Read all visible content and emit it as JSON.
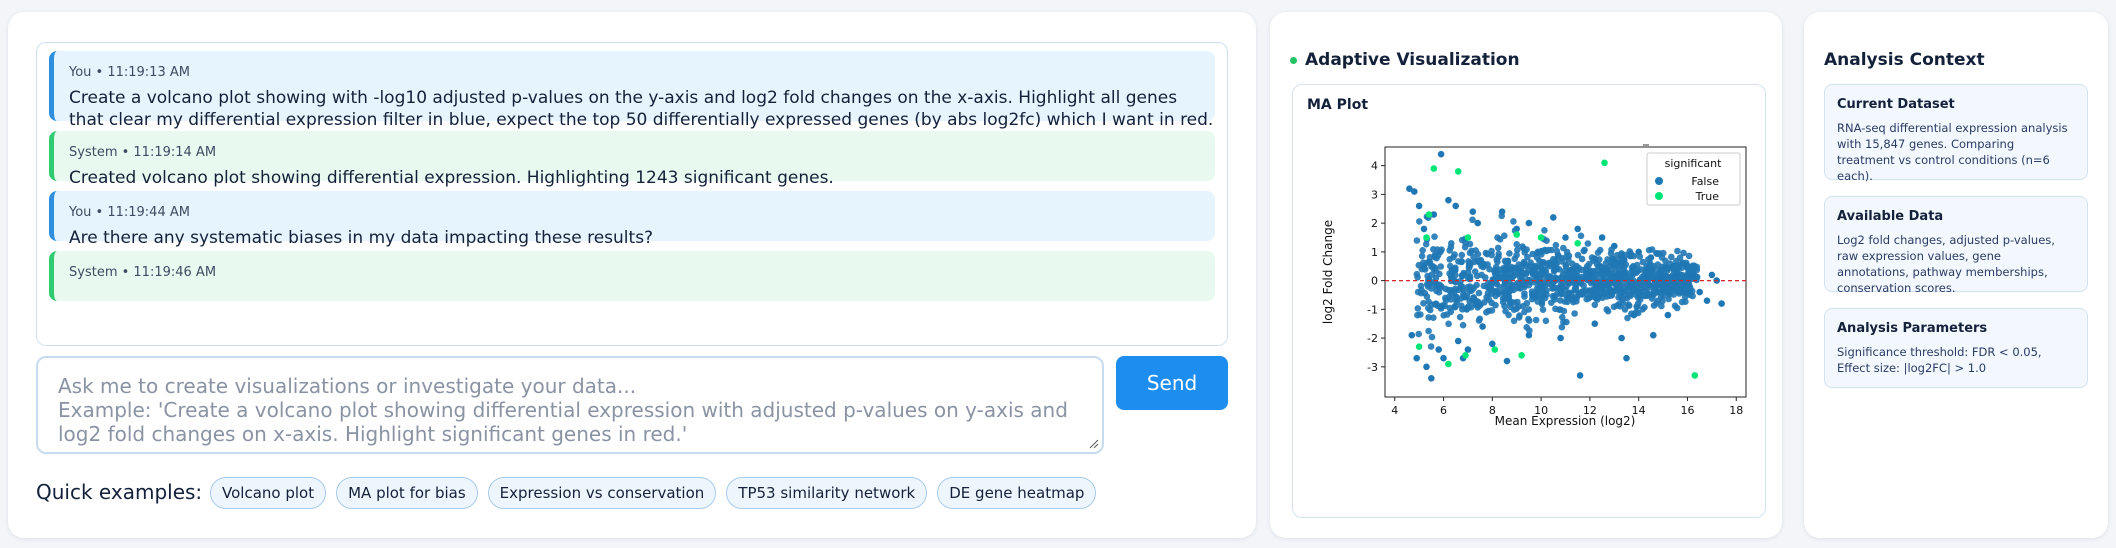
{
  "chat": {
    "messages": [
      {
        "role": "user",
        "meta": "You • 11:19:13 AM",
        "text": "Create a volcano plot showing with -log10 adjusted p-values on the y-axis and log2 fold changes on the x-axis. Highlight all genes that clear my differential expression filter in blue, expect the top 50 differentially expressed genes (by abs log2fc) which I want in red."
      },
      {
        "role": "system",
        "meta": "System • 11:19:14 AM",
        "text": "Created volcano plot showing differential expression. Highlighting 1243 significant genes."
      },
      {
        "role": "user",
        "meta": "You • 11:19:44 AM",
        "text": "Are there any systematic biases in my data impacting these results?"
      },
      {
        "role": "system",
        "meta": "System • 11:19:46 AM",
        "text": ""
      }
    ],
    "input_placeholder": "Ask me to create visualizations or investigate your data...\nExample: 'Create a volcano plot showing differential expression with adjusted p-values on y-axis and log2 fold changes on x-axis. Highlight significant genes in red.'",
    "send_label": "Send",
    "quick_examples_label": "Quick examples:",
    "quick_examples": [
      "Volcano plot",
      "MA plot for bias",
      "Expression vs conservation",
      "TP53 similarity network",
      "DE gene heatmap"
    ]
  },
  "viz": {
    "title": "Adaptive Visualization",
    "card_title": "MA Plot"
  },
  "chart_data": {
    "type": "scatter",
    "title": "",
    "xlabel": "Mean Expression (log2)",
    "ylabel": "log2 Fold Change",
    "xlim": [
      3.6,
      18.4
    ],
    "ylim": [
      -4.05,
      4.65
    ],
    "xticks": [
      4,
      6,
      8,
      10,
      12,
      14,
      16,
      18
    ],
    "yticks": [
      -3,
      -2,
      -1,
      0,
      1,
      2,
      3,
      4
    ],
    "reference_line": {
      "y": 0,
      "color": "#d62728",
      "style": "dashed"
    },
    "legend": {
      "title": "significant",
      "position": "top-right",
      "entries": [
        {
          "name": "False",
          "color": "#1f77b4"
        },
        {
          "name": "True",
          "color": "#00e676"
        }
      ]
    },
    "series": [
      {
        "name": "False",
        "color": "#1f77b4",
        "points": [
          [
            4.6,
            3.2
          ],
          [
            4.8,
            3.1
          ],
          [
            5.9,
            4.4
          ],
          [
            5.0,
            2.6
          ],
          [
            4.9,
            -2.7
          ],
          [
            5.3,
            -3.0
          ],
          [
            5.5,
            -3.4
          ],
          [
            4.7,
            -1.9
          ],
          [
            6.5,
            2.6
          ],
          [
            6.2,
            2.8
          ],
          [
            7.2,
            2.4
          ],
          [
            8.4,
            2.4
          ],
          [
            9.5,
            2.0
          ],
          [
            6.0,
            -2.7
          ],
          [
            7.0,
            -2.4
          ],
          [
            8.0,
            -2.2
          ],
          [
            10.5,
            2.2
          ],
          [
            11.5,
            1.8
          ],
          [
            12.5,
            1.5
          ],
          [
            14.5,
            0.8
          ],
          [
            15.5,
            0.5
          ],
          [
            16.2,
            0.3
          ],
          [
            16.5,
            -0.4
          ],
          [
            17.0,
            0.2
          ],
          [
            17.2,
            0.0
          ],
          [
            17.4,
            -0.8
          ],
          [
            16.8,
            -0.7
          ],
          [
            15.2,
            -1.2
          ],
          [
            14.6,
            -1.9
          ],
          [
            13.3,
            -2.0
          ],
          [
            13.5,
            -2.7
          ],
          [
            11.6,
            -3.3
          ],
          [
            9.5,
            -1.9
          ],
          [
            10.8,
            -2.0
          ],
          [
            12.2,
            -1.5
          ],
          [
            13.8,
            -1.2
          ],
          [
            8.6,
            -2.8
          ],
          [
            6.6,
            -2.1
          ],
          [
            7.6,
            -1.6
          ],
          [
            5.2,
            1.8
          ],
          [
            5.6,
            2.3
          ],
          [
            5.8,
            -2.4
          ],
          [
            9.0,
            1.8
          ],
          [
            11.0,
            1.5
          ],
          [
            13.0,
            1.2
          ],
          [
            14.0,
            1.0
          ],
          [
            16.0,
            -0.2
          ],
          [
            15.8,
            0.6
          ],
          [
            6.8,
            -2.7
          ],
          [
            7.4,
            2.0
          ]
        ]
      },
      {
        "name": "True",
        "color": "#00e676",
        "points": [
          [
            5.6,
            3.9
          ],
          [
            6.6,
            3.8
          ],
          [
            5.4,
            2.3
          ],
          [
            7.0,
            1.5
          ],
          [
            6.2,
            -2.9
          ],
          [
            5.0,
            -2.3
          ],
          [
            6.9,
            -2.6
          ],
          [
            8.1,
            -2.4
          ],
          [
            12.6,
            4.1
          ],
          [
            16.3,
            -3.3
          ],
          [
            9.0,
            1.6
          ],
          [
            10.0,
            1.5
          ],
          [
            11.5,
            1.3
          ],
          [
            9.2,
            -2.6
          ],
          [
            5.3,
            1.5
          ]
        ]
      }
    ]
  },
  "context": {
    "title": "Analysis Context",
    "cards": [
      {
        "title": "Current Dataset",
        "text": "RNA-seq differential expression analysis with 15,847 genes. Comparing treatment vs control conditions (n=6 each)."
      },
      {
        "title": "Available Data",
        "text": "Log2 fold changes, adjusted p-values, raw expression values, gene annotations, pathway memberships, conservation scores."
      },
      {
        "title": "Analysis Parameters",
        "text": "Significance threshold: FDR < 0.05, Effect size: |log2FC| > 1.0"
      }
    ]
  }
}
